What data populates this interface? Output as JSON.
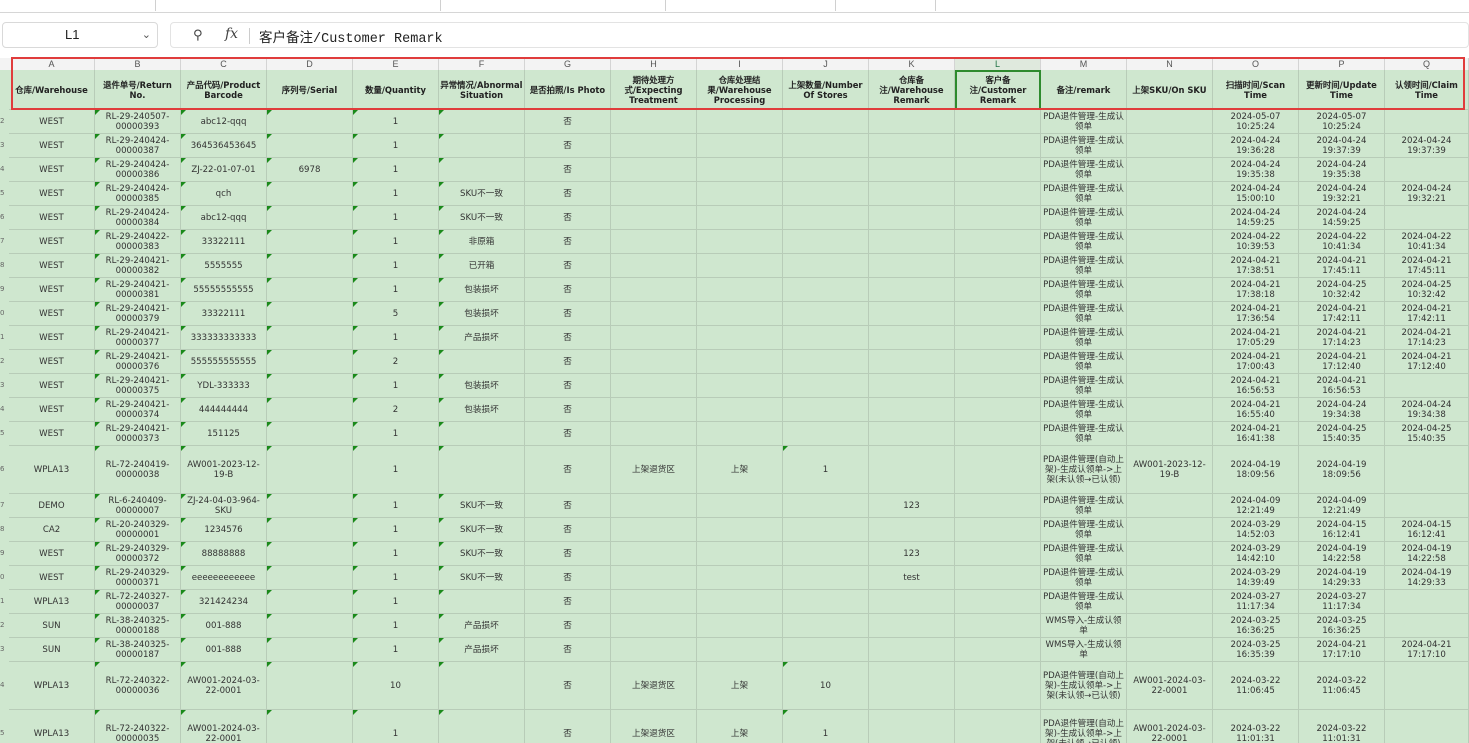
{
  "name_box": {
    "value": "L1"
  },
  "formula_bar": {
    "content": "客户备注/Customer Remark",
    "zoom_icon": "zoom-search-icon",
    "fx_icon": "fx-icon"
  },
  "column_letters": [
    "A",
    "B",
    "C",
    "D",
    "E",
    "F",
    "G",
    "H",
    "I",
    "J",
    "K",
    "L",
    "M",
    "N",
    "O",
    "P",
    "Q"
  ],
  "selected_column": "L",
  "headers": [
    "仓库/Warehouse",
    "退件单号/Return No.",
    "产品代码/Product Barcode",
    "序列号/Serial",
    "数量/Quantity",
    "异常情况/Abnormal Situation",
    "是否拍照/Is Photo",
    "期待处理方式/Expecting Treatment",
    "仓库处理结果/Warehouse Processing",
    "上架数量/Number Of Stores",
    "仓库备注/Warehouse Remark",
    "客户备注/Customer Remark",
    "备注/remark",
    "上架SKU/On SKU",
    "扫描时间/Scan Time",
    "更新时间/Update Time",
    "认领时间/Claim Time"
  ],
  "rows": [
    [
      "WEST",
      "RL-29-240507-00000393",
      "abc12-qqq",
      "",
      "1",
      "",
      "否",
      "",
      "",
      "",
      "",
      "",
      "PDA退件管理-生成认领单",
      "",
      "2024-05-07 10:25:24",
      "2024-05-07 10:25:24",
      ""
    ],
    [
      "WEST",
      "RL-29-240424-00000387",
      "364536453645",
      "",
      "1",
      "",
      "否",
      "",
      "",
      "",
      "",
      "",
      "PDA退件管理-生成认领单",
      "",
      "2024-04-24 19:36:28",
      "2024-04-24 19:37:39",
      "2024-04-24 19:37:39"
    ],
    [
      "WEST",
      "RL-29-240424-00000386",
      "ZJ-22-01-07-01",
      "6978",
      "1",
      "",
      "否",
      "",
      "",
      "",
      "",
      "",
      "PDA退件管理-生成认领单",
      "",
      "2024-04-24 19:35:38",
      "2024-04-24 19:35:38",
      ""
    ],
    [
      "WEST",
      "RL-29-240424-00000385",
      "qch",
      "",
      "1",
      "SKU不一致",
      "否",
      "",
      "",
      "",
      "",
      "",
      "PDA退件管理-生成认领单",
      "",
      "2024-04-24 15:00:10",
      "2024-04-24 19:32:21",
      "2024-04-24 19:32:21"
    ],
    [
      "WEST",
      "RL-29-240424-00000384",
      "abc12-qqq",
      "",
      "1",
      "SKU不一致",
      "否",
      "",
      "",
      "",
      "",
      "",
      "PDA退件管理-生成认领单",
      "",
      "2024-04-24 14:59:25",
      "2024-04-24 14:59:25",
      ""
    ],
    [
      "WEST",
      "RL-29-240422-00000383",
      "33322111",
      "",
      "1",
      "非原箱",
      "否",
      "",
      "",
      "",
      "",
      "",
      "PDA退件管理-生成认领单",
      "",
      "2024-04-22 10:39:53",
      "2024-04-22 10:41:34",
      "2024-04-22 10:41:34"
    ],
    [
      "WEST",
      "RL-29-240421-00000382",
      "5555555",
      "",
      "1",
      "已开箱",
      "否",
      "",
      "",
      "",
      "",
      "",
      "PDA退件管理-生成认领单",
      "",
      "2024-04-21 17:38:51",
      "2024-04-21 17:45:11",
      "2024-04-21 17:45:11"
    ],
    [
      "WEST",
      "RL-29-240421-00000381",
      "55555555555",
      "",
      "1",
      "包装损坏",
      "否",
      "",
      "",
      "",
      "",
      "",
      "PDA退件管理-生成认领单",
      "",
      "2024-04-21 17:38:18",
      "2024-04-25 10:32:42",
      "2024-04-25 10:32:42"
    ],
    [
      "WEST",
      "RL-29-240421-00000379",
      "33322111",
      "",
      "5",
      "包装损坏",
      "否",
      "",
      "",
      "",
      "",
      "",
      "PDA退件管理-生成认领单",
      "",
      "2024-04-21 17:36:54",
      "2024-04-21 17:42:11",
      "2024-04-21 17:42:11"
    ],
    [
      "WEST",
      "RL-29-240421-00000377",
      "333333333333",
      "",
      "1",
      "产品损坏",
      "否",
      "",
      "",
      "",
      "",
      "",
      "PDA退件管理-生成认领单",
      "",
      "2024-04-21 17:05:29",
      "2024-04-21 17:14:23",
      "2024-04-21 17:14:23"
    ],
    [
      "WEST",
      "RL-29-240421-00000376",
      "555555555555",
      "",
      "2",
      "",
      "否",
      "",
      "",
      "",
      "",
      "",
      "PDA退件管理-生成认领单",
      "",
      "2024-04-21 17:00:43",
      "2024-04-21 17:12:40",
      "2024-04-21 17:12:40"
    ],
    [
      "WEST",
      "RL-29-240421-00000375",
      "YDL-333333",
      "",
      "1",
      "包装损坏",
      "否",
      "",
      "",
      "",
      "",
      "",
      "PDA退件管理-生成认领单",
      "",
      "2024-04-21 16:56:53",
      "2024-04-21 16:56:53",
      ""
    ],
    [
      "WEST",
      "RL-29-240421-00000374",
      "444444444",
      "",
      "2",
      "包装损坏",
      "否",
      "",
      "",
      "",
      "",
      "",
      "PDA退件管理-生成认领单",
      "",
      "2024-04-21 16:55:40",
      "2024-04-24 19:34:38",
      "2024-04-24 19:34:38"
    ],
    [
      "WEST",
      "RL-29-240421-00000373",
      "151125",
      "",
      "1",
      "",
      "否",
      "",
      "",
      "",
      "",
      "",
      "PDA退件管理-生成认领单",
      "",
      "2024-04-21 16:41:38",
      "2024-04-25 15:40:35",
      "2024-04-25 15:40:35"
    ],
    [
      "WPLA13",
      "RL-72-240419-00000038",
      "AW001-2023-12-19-B",
      "",
      "1",
      "",
      "否",
      "上架退货区",
      "上架",
      "1",
      "",
      "",
      "PDA退件管理(自动上架)-生成认领单->上架(未认领→已认领)",
      "AW001-2023-12-19-B",
      "2024-04-19 18:09:56",
      "2024-04-19 18:09:56",
      ""
    ],
    [
      "DEMO",
      "RL-6-240409-00000007",
      "ZJ-24-04-03-964-SKU",
      "",
      "1",
      "SKU不一致",
      "否",
      "",
      "",
      "",
      "123",
      "",
      "PDA退件管理-生成认领单",
      "",
      "2024-04-09 12:21:49",
      "2024-04-09 12:21:49",
      ""
    ],
    [
      "CA2",
      "RL-20-240329-00000001",
      "1234576",
      "",
      "1",
      "SKU不一致",
      "否",
      "",
      "",
      "",
      "",
      "",
      "PDA退件管理-生成认领单",
      "",
      "2024-03-29 14:52:03",
      "2024-04-15 16:12:41",
      "2024-04-15 16:12:41"
    ],
    [
      "WEST",
      "RL-29-240329-00000372",
      "88888888",
      "",
      "1",
      "SKU不一致",
      "否",
      "",
      "",
      "",
      "123",
      "",
      "PDA退件管理-生成认领单",
      "",
      "2024-03-29 14:42:10",
      "2024-04-19 14:22:58",
      "2024-04-19 14:22:58"
    ],
    [
      "WEST",
      "RL-29-240329-00000371",
      "eeeeeeeeeeee",
      "",
      "1",
      "SKU不一致",
      "否",
      "",
      "",
      "",
      "test",
      "",
      "PDA退件管理-生成认领单",
      "",
      "2024-03-29 14:39:49",
      "2024-04-19 14:29:33",
      "2024-04-19 14:29:33"
    ],
    [
      "WPLA13",
      "RL-72-240327-00000037",
      "321424234",
      "",
      "1",
      "",
      "否",
      "",
      "",
      "",
      "",
      "",
      "PDA退件管理-生成认领单",
      "",
      "2024-03-27 11:17:34",
      "2024-03-27 11:17:34",
      ""
    ],
    [
      "SUN",
      "RL-38-240325-00000188",
      "001-888",
      "",
      "1",
      "产品损坏",
      "否",
      "",
      "",
      "",
      "",
      "",
      "WMS导入-生成认领单",
      "",
      "2024-03-25 16:36:25",
      "2024-03-25 16:36:25",
      ""
    ],
    [
      "SUN",
      "RL-38-240325-00000187",
      "001-888",
      "",
      "1",
      "产品损坏",
      "否",
      "",
      "",
      "",
      "",
      "",
      "WMS导入-生成认领单",
      "",
      "2024-03-25 16:35:39",
      "2024-04-21 17:17:10",
      "2024-04-21 17:17:10"
    ],
    [
      "WPLA13",
      "RL-72-240322-00000036",
      "AW001-2024-03-22-0001",
      "",
      "10",
      "",
      "否",
      "上架退货区",
      "上架",
      "10",
      "",
      "",
      "PDA退件管理(自动上架)-生成认领单->上架(未认领→已认领)",
      "AW001-2024-03-22-0001",
      "2024-03-22 11:06:45",
      "2024-03-22 11:06:45",
      ""
    ],
    [
      "WPLA13",
      "RL-72-240322-00000035",
      "AW001-2024-03-22-0001",
      "",
      "1",
      "",
      "否",
      "上架退货区",
      "上架",
      "1",
      "",
      "",
      "PDA退件管理(自动上架)-生成认领单->上架(未认领→已认领)",
      "AW001-2024-03-22-0001",
      "2024-03-22 11:01:31",
      "2024-03-22 11:01:31",
      ""
    ]
  ],
  "colors": {
    "cell_fill": "#cfe7cf",
    "highlight_box": "#e03c3c",
    "selected_cell": "#2e8b2e"
  }
}
